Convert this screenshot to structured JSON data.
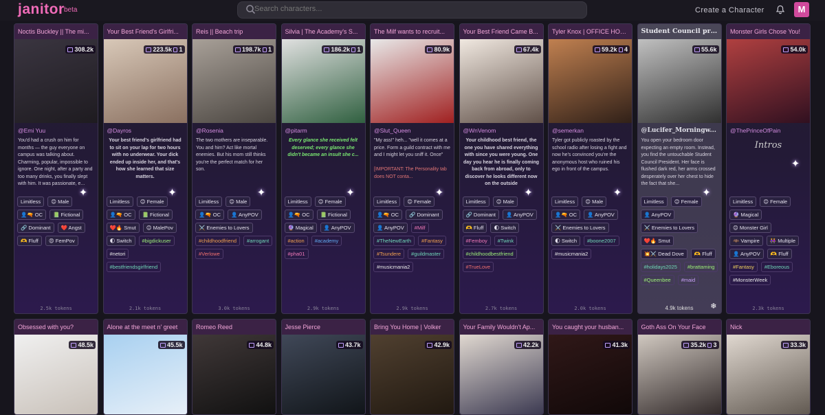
{
  "header": {
    "logo": "janitor",
    "beta": "beta",
    "search_placeholder": "Search characters...",
    "create_label": "Create a Character",
    "avatar_letter": "M"
  },
  "row1": [
    {
      "title": "Noctis Buckley || The mi...",
      "stat": "308.2k",
      "stat2": "",
      "author": "@Emi Yuu",
      "desc": "You'd had a crush on him for months — the guy everyone on campus was talking about. Charming, popular, impossible to ignore. One night, after a party and too many drinks, you finally slept with him. It was passionate, e...",
      "tags": [
        [
          "Limitless",
          ""
        ],
        [
          "😊 Male",
          ""
        ],
        [
          "👤🔫 OC",
          ""
        ],
        [
          "📗 Fictional",
          ""
        ],
        [
          "🔗 Dominant",
          ""
        ],
        [
          "❤️ Angst",
          ""
        ],
        [
          "🫶 Fluff",
          ""
        ],
        [
          "😍 FemPov",
          ""
        ]
      ],
      "tokens": "2.5k tokens",
      "grad": "#3a3540,#1e1b20"
    },
    {
      "title": "Your Best Friend's Girlfri...",
      "stat": "223.5k",
      "stat2": "1",
      "author": "@Dayros",
      "desc": "Your best friend's girlfriend had to sit on your lap for two hours with no underwear. Your dick ended up inside her, and that's how she learned that size matters.",
      "desc_style": "bold",
      "tags": [
        [
          "Limitless",
          ""
        ],
        [
          "😊 Female",
          ""
        ],
        [
          "👤🔫 OC",
          ""
        ],
        [
          "📗 Fictional",
          ""
        ],
        [
          "❤️🔥 Smut",
          ""
        ],
        [
          "😊 MalePov",
          ""
        ],
        [
          "🌓 Switch",
          ""
        ],
        [
          "#bigdickuser",
          "green"
        ],
        [
          "#netori",
          "white"
        ],
        [
          "#bestfriendsgirlfriend",
          "teal"
        ]
      ],
      "tokens": "2.1k tokens",
      "grad": "#d8c8b8,#8a7060"
    },
    {
      "title": "Reis || Beach trip",
      "stat": "198.7k",
      "stat2": "1",
      "author": "@Rosenia",
      "desc": "The two mothers are inseparable. You and him? Act like mortal enemies. But his mom still thinks you're the perfect match for her son.",
      "tags": [
        [
          "Limitless",
          ""
        ],
        [
          "😊 Male",
          ""
        ],
        [
          "👤🔫 OC",
          ""
        ],
        [
          "👤 AnyPOV",
          ""
        ],
        [
          "⚔️ Enemies to Lovers",
          ""
        ],
        [
          "#childhoodfriend",
          "orange"
        ],
        [
          "#arrogant",
          "teal"
        ],
        [
          "#Verlowe",
          "red"
        ]
      ],
      "tokens": "3.0k tokens",
      "grad": "#a8a098,#4a4540"
    },
    {
      "title": "Silvia | The Academy's S...",
      "stat": "186.2k",
      "stat2": "1",
      "author": "@pitarm",
      "desc": "Every glance she received felt deserved; every glance she didn't became an insult she c...",
      "desc_style": "ital",
      "tags": [
        [
          "Limitless",
          ""
        ],
        [
          "😊 Female",
          ""
        ],
        [
          "👤🔫 OC",
          ""
        ],
        [
          "📗 Fictional",
          ""
        ],
        [
          "🔮 Magical",
          ""
        ],
        [
          "👤 AnyPOV",
          ""
        ],
        [
          "#action",
          "orange"
        ],
        [
          "#academy",
          "blue"
        ],
        [
          "#pha01",
          "pink"
        ]
      ],
      "tokens": "2.9k tokens",
      "grad": "#e0e0e0,#306040"
    },
    {
      "title": "The Milf wants to recruit...",
      "stat": "80.9k",
      "stat2": "",
      "author": "@Slut_Queen",
      "desc": "\"My ass!\" heh... \"well it comes at a price. Form a guild contract with me and I might let you sniff it. Once\"",
      "warn": "[IMPORTANT: The Personality tab does NOT conta...",
      "tags": [
        [
          "Limitless",
          ""
        ],
        [
          "😊 Female",
          ""
        ],
        [
          "👤🔫 OC",
          ""
        ],
        [
          "🔗 Dominant",
          ""
        ],
        [
          "👤 AnyPOV",
          ""
        ],
        [
          "#Milf",
          "pink"
        ],
        [
          "#TheNewEarth",
          "teal"
        ],
        [
          "#Fantasy",
          "orange"
        ],
        [
          "#Tsundere",
          "orange"
        ],
        [
          "#guildmaster",
          "teal"
        ],
        [
          "#musicmania2",
          "white"
        ]
      ],
      "tokens": "2.9k tokens",
      "grad": "#e8e8e8,#a02020"
    },
    {
      "title": "Your Best Friend Came B...",
      "stat": "67.4k",
      "stat2": "",
      "author": "@WnVenom",
      "desc": "Your childhood best friend, the one you have shared everything with since you were young. One day you hear he is finally coming back from abroad, only to discover he looks different now on the outside",
      "desc_style": "bold",
      "tags": [
        [
          "Limitless",
          ""
        ],
        [
          "😊 Male",
          ""
        ],
        [
          "🔗 Dominant",
          ""
        ],
        [
          "👤 AnyPOV",
          ""
        ],
        [
          "🫶 Fluff",
          ""
        ],
        [
          "🌓 Switch",
          ""
        ],
        [
          "#Femboy",
          "pink"
        ],
        [
          "#Twink",
          "teal"
        ],
        [
          "#childhoodbestfriend",
          "green"
        ],
        [
          "#TrueLove",
          "red"
        ]
      ],
      "tokens": "2.7k tokens",
      "grad": "#f0e8e0,#605048"
    },
    {
      "title": "Tyler Knox | OFFICE HOURS",
      "stat": "59.2k",
      "stat2": "4",
      "author": "@semerkan",
      "desc": "Tyler got publicly roasted by the school radio after losing a fight and now he's convinced you're the anonymous host who ruined his ego in front of the campus.",
      "tags": [
        [
          "Limitless",
          ""
        ],
        [
          "😊 Male",
          ""
        ],
        [
          "👤🔫 OC",
          ""
        ],
        [
          "👤 AnyPOV",
          ""
        ],
        [
          "⚔️ Enemies to Lovers",
          ""
        ],
        [
          "🌓 Switch",
          ""
        ],
        [
          "#boone2007",
          "teal"
        ],
        [
          "#musicmania2",
          "white"
        ]
      ],
      "tokens": "2.0k tokens",
      "grad": "#c08050,#302018"
    },
    {
      "title": "Student Council presi...",
      "stat": "55.6k",
      "stat2": "",
      "author": "@Lucifer_Morningw...",
      "desc": "You open your bedroom door expecting an empty room. Instead, you find the untouchable Student Council President. Her face is flushed dark red, her arms crossed desperately over her chest to hide the fact that she...",
      "tags": [
        [
          "Limitless",
          ""
        ],
        [
          "😊 Female",
          ""
        ],
        [
          "👤 AnyPOV",
          ""
        ],
        [
          "⚔️ Enemies to Lovers",
          ""
        ],
        [
          "❤️🔥 Smut",
          ""
        ],
        [
          "💥⚔️ Dead Dove",
          ""
        ],
        [
          "🫶 Fluff",
          ""
        ],
        [
          "#holidays2025",
          "teal"
        ],
        [
          "#brattaming",
          "green"
        ],
        [
          "#Queenbee",
          "green"
        ],
        [
          "#maid",
          "purple"
        ]
      ],
      "tokens": "4.9k tokens",
      "grad": "#c0c0c0,#303030",
      "hl": true
    },
    {
      "title": "Monster Girls Chose You!",
      "stat": "54.0k",
      "stat2": "",
      "author": "@ThePrinceOfPain",
      "intros": "Intros",
      "tags": [
        [
          "Limitless",
          ""
        ],
        [
          "😊 Female",
          ""
        ],
        [
          "🔮 Magical",
          ""
        ],
        [
          "😊 Monster Girl",
          ""
        ],
        [
          "🦇 Vampire",
          ""
        ],
        [
          "👭 Multiple",
          ""
        ],
        [
          "👤 AnyPOV",
          ""
        ],
        [
          "🫶 Fluff",
          ""
        ],
        [
          "#Fantasy",
          "yellow"
        ],
        [
          "#Eboreous",
          "teal"
        ],
        [
          "#MonsterWeek",
          "white"
        ]
      ],
      "tokens": "2.3k tokens",
      "grad": "#b04040,#301020"
    }
  ],
  "row2": [
    {
      "title": "Obsessed with you?",
      "stat": "48.5k",
      "stat2": "",
      "grad": "#f0f0f0,#c8c0b8"
    },
    {
      "title": "Alone at the meet n' greet",
      "stat": "45.5k",
      "stat2": "",
      "grad": "#a8d0f0,#e8f0f8"
    },
    {
      "title": "Romeo  Reed",
      "stat": "44.8k",
      "stat2": "",
      "grad": "#403838,#101010"
    },
    {
      "title": "Jesse Pierce",
      "stat": "43.7k",
      "stat2": "",
      "grad": "#404858,#101418"
    },
    {
      "title": "Bring You Home | Volker",
      "stat": "42.9k",
      "stat2": "",
      "grad": "#504030,#201810"
    },
    {
      "title": "Your Family Wouldn't Ap...",
      "stat": "42.2k",
      "stat2": "",
      "grad": "#e0d8d0,#3a3850"
    },
    {
      "title": "You caught your husban...",
      "stat": "41.3k",
      "stat2": "",
      "grad": "#301818,#100808"
    },
    {
      "title": "Goth Ass On Your Face",
      "stat": "35.2k",
      "stat2": "3",
      "grad": "#d0c8c0,#302828"
    },
    {
      "title": "Nick",
      "stat": "33.3k",
      "stat2": "",
      "grad": "#e0d8d0,#605850"
    }
  ]
}
